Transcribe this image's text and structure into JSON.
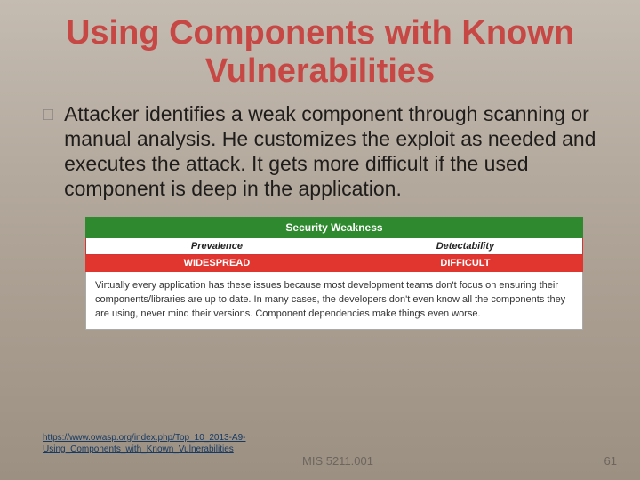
{
  "title": "Using Components with Known Vulnerabilities",
  "bullet_icon": "□",
  "paragraph": "Attacker identifies a weak component through scanning or manual analysis. He customizes the exploit as needed and executes the attack. It gets more difficult if the used component is deep in the application.",
  "table": {
    "header": "Security Weakness",
    "sub": {
      "col1": "Prevalence",
      "col2": "Detectability"
    },
    "metric": {
      "col1": "WIDESPREAD",
      "col2": "DIFFICULT"
    },
    "description": "Virtually every application has these issues because most development teams don't focus on ensuring their components/libraries are up to date. In many cases, the developers don't even know all the components they are using, never mind their versions. Component dependencies make things even worse."
  },
  "link_text": "https://www.owasp.org/index.php/Top_10_2013-A9-Using_Components_with_Known_Vulnerabilities",
  "course": "MIS 5211.001",
  "page_number": "61"
}
